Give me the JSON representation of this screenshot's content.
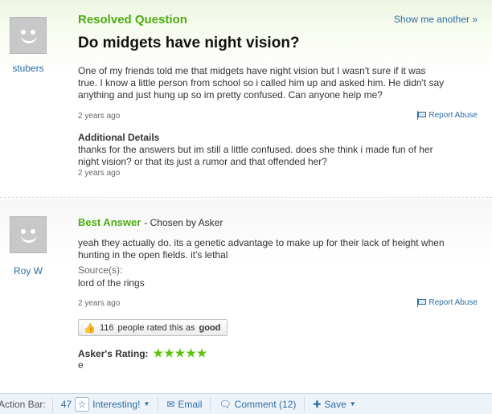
{
  "question": {
    "status": "Resolved Question",
    "show_another": "Show me another »",
    "title": "Do midgets have night vision?",
    "asker": "stubers",
    "body_lines": [
      "One of my friends told me that midgets have night vision but I wasn't sure if it was",
      "true. I know a little person from school so i called him up and asked him. He didn't say",
      "anything and just hung up so im pretty confused. Can anyone help me?"
    ],
    "time": "2 years ago",
    "report": "Report Abuse",
    "additional_heading": "Additional Details",
    "additional_lines": [
      "thanks for the answers but im still a little confused. does she think i made fun of her",
      "night vision? or that its just a rumor and that offended her?"
    ],
    "additional_time": "2 years ago"
  },
  "answer": {
    "best_label": "Best Answer",
    "chosen_by": "- Chosen by Asker",
    "answerer": "Roy W",
    "body_lines": [
      "yeah they actually do. its a genetic advantage to make up for their lack of height when",
      "hunting in the open fields. it's lethal"
    ],
    "sources_label": "Source(s):",
    "source": "lord of the rings",
    "time": "2 years ago",
    "report": "Report Abuse",
    "rated_count": "116",
    "rated_text": "people rated this as",
    "rated_word": "good",
    "asker_rating_label": "Asker's Rating:",
    "asker_rating_stars": 5,
    "asker_rating_stars_text": "★★★★★",
    "asker_comment": "e",
    "star_color": "#5cc20c"
  },
  "action_bar": {
    "label": "Action Bar:",
    "interesting_count": "47",
    "interesting": "Interesting!",
    "email": "Email",
    "comment": "Comment (12)",
    "save": "Save"
  },
  "colors": {
    "accent_green": "#4cae11",
    "link_blue": "#2d6da3"
  },
  "icons": [
    "avatar-icon",
    "flag-icon",
    "thumbs-up-icon",
    "star-icon",
    "mail-icon",
    "comment-icon",
    "plus-icon",
    "chevron-down-icon"
  ]
}
